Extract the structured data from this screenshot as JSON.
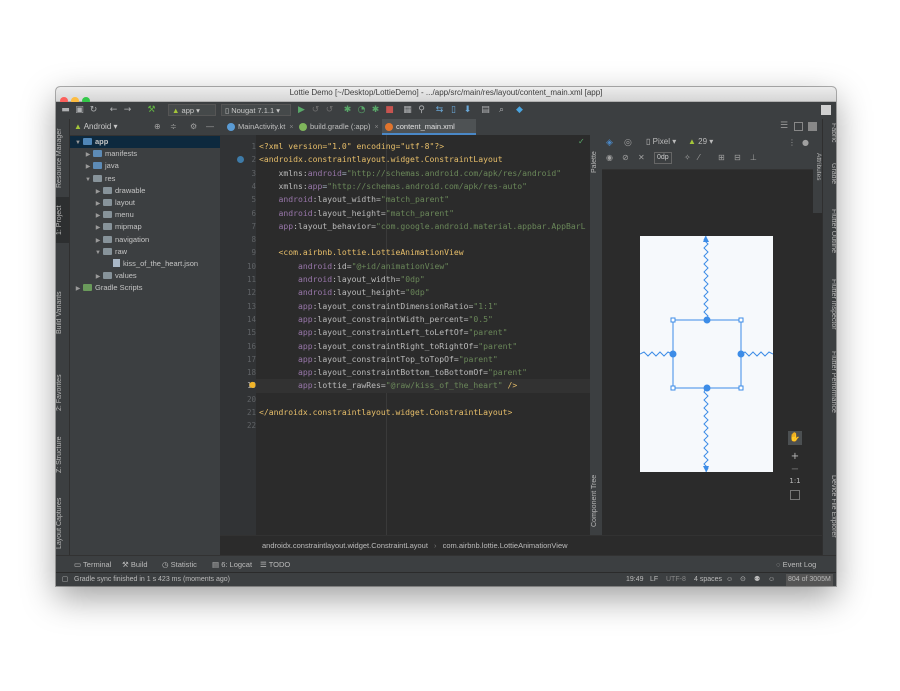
{
  "window": {
    "title": "Lottie Demo [~/Desktop/LottieDemo] - .../app/src/main/res/layout/content_main.xml [app]"
  },
  "toolbar": {
    "module": "app",
    "device": "Nougat 7.1.1"
  },
  "left_tabs": {
    "resource_manager": "Resource Manager",
    "project": "1: Project",
    "build_variants": "Build Variants",
    "favorites": "2: Favorites",
    "structure": "Z: Structure",
    "layout_captures": "Layout Captures"
  },
  "right_tabs": {
    "fabric": "Fabric",
    "gradle": "Gradle",
    "flutter_outline": "Flutter Outline",
    "flutter_inspector": "Flutter Inspector",
    "flutter_performance": "Flutter Performance",
    "device_file_explorer": "Device File Explorer"
  },
  "project": {
    "view": "Android",
    "items": [
      {
        "label": "app",
        "depth": 0,
        "arrow": "▼",
        "kind": "module",
        "selected": true
      },
      {
        "label": "manifests",
        "depth": 1,
        "arrow": "▶",
        "kind": "folder"
      },
      {
        "label": "java",
        "depth": 1,
        "arrow": "▶",
        "kind": "folder"
      },
      {
        "label": "res",
        "depth": 1,
        "arrow": "▼",
        "kind": "folder"
      },
      {
        "label": "drawable",
        "depth": 2,
        "arrow": "▶",
        "kind": "folder"
      },
      {
        "label": "layout",
        "depth": 2,
        "arrow": "▶",
        "kind": "folder"
      },
      {
        "label": "menu",
        "depth": 2,
        "arrow": "▶",
        "kind": "folder"
      },
      {
        "label": "mipmap",
        "depth": 2,
        "arrow": "▶",
        "kind": "folder"
      },
      {
        "label": "navigation",
        "depth": 2,
        "arrow": "▶",
        "kind": "folder"
      },
      {
        "label": "raw",
        "depth": 2,
        "arrow": "▼",
        "kind": "folder"
      },
      {
        "label": "kiss_of_the_heart.json",
        "depth": 3,
        "arrow": "",
        "kind": "file"
      },
      {
        "label": "values",
        "depth": 2,
        "arrow": "▶",
        "kind": "folder"
      },
      {
        "label": "Gradle Scripts",
        "depth": 0,
        "arrow": "▶",
        "kind": "gradle"
      }
    ]
  },
  "tabs": [
    {
      "label": "MainActivity.kt",
      "active": false,
      "color": "#5a9bd4"
    },
    {
      "label": "build.gradle (:app)",
      "active": false,
      "color": "#7fb55b"
    },
    {
      "label": "content_main.xml",
      "active": true,
      "color": "#e0742d"
    }
  ],
  "editor": {
    "current_line": 19,
    "lines": [
      [
        [
          "<?xml version=\"1.0\" encoding=\"utf-8\"?>",
          "tg"
        ]
      ],
      [
        [
          "<androidx.constraintlayout.widget.ConstraintLayout",
          "tg"
        ]
      ],
      [
        [
          "    xmlns:",
          "at"
        ],
        [
          "android",
          "ns"
        ],
        [
          "=",
          "pl"
        ],
        [
          "\"http://schemas.android.com/apk/res/android\"",
          "vl"
        ]
      ],
      [
        [
          "    xmlns:",
          "at"
        ],
        [
          "app",
          "ns"
        ],
        [
          "=",
          "pl"
        ],
        [
          "\"http://schemas.android.com/apk/res-auto\"",
          "vl"
        ]
      ],
      [
        [
          "    ",
          "pl"
        ],
        [
          "android",
          "ns"
        ],
        [
          ":layout_width=",
          "at"
        ],
        [
          "\"match_parent\"",
          "vl"
        ]
      ],
      [
        [
          "    ",
          "pl"
        ],
        [
          "android",
          "ns"
        ],
        [
          ":layout_height=",
          "at"
        ],
        [
          "\"match_parent\"",
          "vl"
        ]
      ],
      [
        [
          "    ",
          "pl"
        ],
        [
          "app",
          "ns"
        ],
        [
          ":layout_behavior=",
          "at"
        ],
        [
          "\"com.google.android.material.appbar.AppBarL",
          "vl"
        ]
      ],
      [
        [
          "",
          "pl"
        ]
      ],
      [
        [
          "    <com.airbnb.lottie.LottieAnimationView",
          "tg"
        ]
      ],
      [
        [
          "        ",
          "pl"
        ],
        [
          "android",
          "ns"
        ],
        [
          ":id=",
          "at"
        ],
        [
          "\"@+id/animationView\"",
          "vl"
        ]
      ],
      [
        [
          "        ",
          "pl"
        ],
        [
          "android",
          "ns"
        ],
        [
          ":layout_width=",
          "at"
        ],
        [
          "\"0dp\"",
          "vl"
        ]
      ],
      [
        [
          "        ",
          "pl"
        ],
        [
          "android",
          "ns"
        ],
        [
          ":layout_height=",
          "at"
        ],
        [
          "\"0dp\"",
          "vl"
        ]
      ],
      [
        [
          "        ",
          "pl"
        ],
        [
          "app",
          "ns"
        ],
        [
          ":layout_constraintDimensionRatio=",
          "at"
        ],
        [
          "\"1:1\"",
          "vl"
        ]
      ],
      [
        [
          "        ",
          "pl"
        ],
        [
          "app",
          "ns"
        ],
        [
          ":layout_constraintWidth_percent=",
          "at"
        ],
        [
          "\"0.5\"",
          "vl"
        ]
      ],
      [
        [
          "        ",
          "pl"
        ],
        [
          "app",
          "ns"
        ],
        [
          ":layout_constraintLeft_toLeftOf=",
          "at"
        ],
        [
          "\"parent\"",
          "vl"
        ]
      ],
      [
        [
          "        ",
          "pl"
        ],
        [
          "app",
          "ns"
        ],
        [
          ":layout_constraintRight_toRightOf=",
          "at"
        ],
        [
          "\"parent\"",
          "vl"
        ]
      ],
      [
        [
          "        ",
          "pl"
        ],
        [
          "app",
          "ns"
        ],
        [
          ":layout_constraintTop_toTopOf=",
          "at"
        ],
        [
          "\"parent\"",
          "vl"
        ]
      ],
      [
        [
          "        ",
          "pl"
        ],
        [
          "app",
          "ns"
        ],
        [
          ":layout_constraintBottom_toBottomOf=",
          "at"
        ],
        [
          "\"parent\"",
          "vl"
        ]
      ],
      [
        [
          "        ",
          "pl"
        ],
        [
          "app",
          "ns"
        ],
        [
          ":lottie_rawRes=",
          "at"
        ],
        [
          "\"@raw/kiss_of_the_heart\"",
          "vl"
        ],
        [
          " />",
          "tg"
        ]
      ],
      [
        [
          "",
          "pl"
        ]
      ],
      [
        [
          "</androidx.constraintlayout.widget.ConstraintLayout>",
          "tg"
        ]
      ],
      [
        [
          "",
          "pl"
        ]
      ]
    ]
  },
  "design": {
    "palette": "Palette",
    "component_tree": "Component Tree",
    "attributes": "Attributes",
    "device": "Pixel",
    "api": "29",
    "margin": "0dp",
    "zoom_ratio": "1:1"
  },
  "breadcrumbs": [
    "androidx.constraintlayout.widget.ConstraintLayout",
    "com.airbnb.lottie.LottieAnimationView"
  ],
  "bottom_tabs": [
    "Terminal",
    "Build",
    "Statistic",
    "6: Logcat",
    "TODO"
  ],
  "event_log": "Event Log",
  "status": {
    "message": "Gradle sync finished in 1 s 423 ms (moments ago)",
    "position": "19:49",
    "line_sep": "LF",
    "encoding": "UTF-8",
    "indent": "4 spaces",
    "memory": "804 of 3005M"
  }
}
